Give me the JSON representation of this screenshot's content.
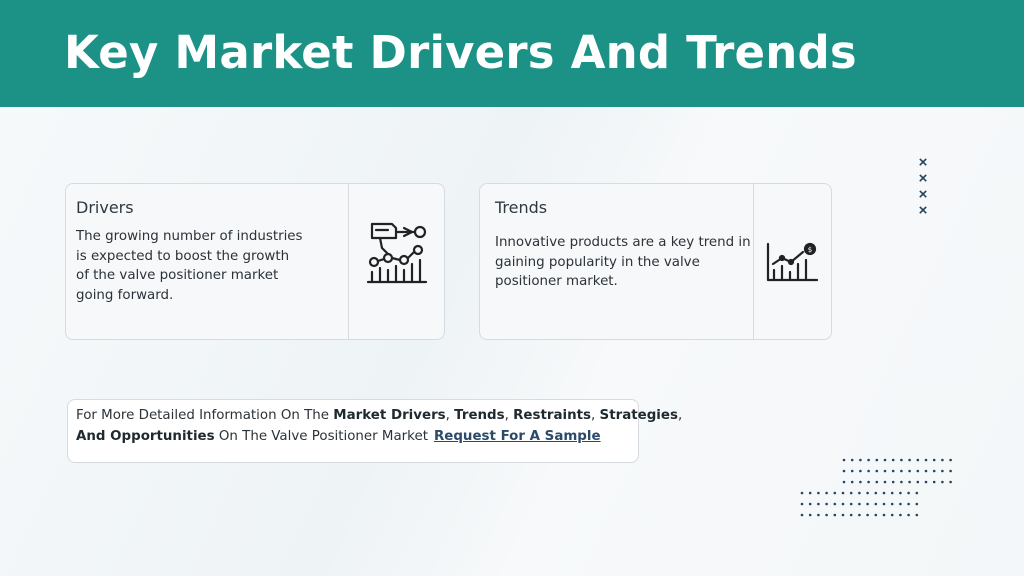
{
  "page": {
    "title": "Key Market Drivers And Trends"
  },
  "drivers": {
    "title": "Drivers",
    "lines": [
      "The growing number of industries",
      "is expected to boost the growth",
      "of the valve positioner market",
      "going forward."
    ],
    "icon": "industry-growth-icon"
  },
  "trends": {
    "title": "Trends",
    "lines": [
      "Innovative products are a key trend in",
      "gaining popularity in the valve",
      "positioner market."
    ],
    "icon": "chart-growth-icon"
  },
  "info": {
    "line1_prefix": "For More Detailed Information On The ",
    "line1_b1": "Market Drivers",
    "sep1": ", ",
    "line1_b2": "Trends",
    "sep2": ", ",
    "line1_b3": "Restraints",
    "sep3": ", ",
    "line1_b4": "Strategies",
    "sep4": ",",
    "line2_b1": "And Opportunities",
    "line2_mid": " On The Valve Positioner Market",
    "link_label": "Request For A Sample"
  },
  "decor": {
    "x_marks": [
      "×",
      "×",
      "×",
      "×"
    ]
  },
  "colors": {
    "header": "#1c9186",
    "accent_dark": "#25445e",
    "link": "#2b4a6a"
  }
}
